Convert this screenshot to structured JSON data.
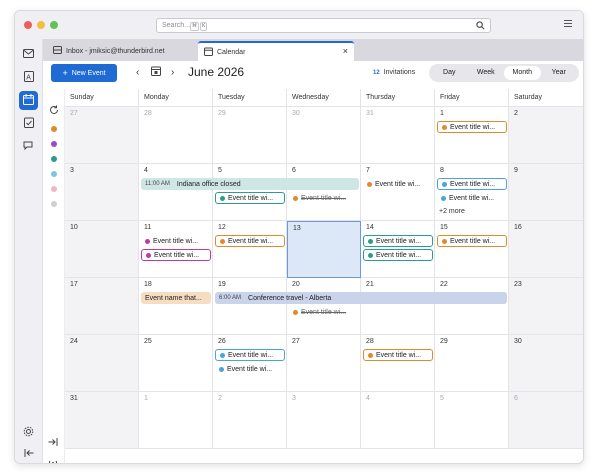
{
  "titlebar": {
    "search_placeholder": "Search...",
    "search_keys": [
      "⌘",
      "K"
    ]
  },
  "tabs": [
    {
      "label": "Inbox - jmiksic@thunderbird.net"
    },
    {
      "label": "Calendar"
    }
  ],
  "toolbar": {
    "new_event": "New Event",
    "month_label": "June 2026",
    "invitations_count": "12",
    "invitations_label": "Invitations",
    "views": [
      "Day",
      "Week",
      "Month",
      "Year"
    ],
    "active_view": "Month"
  },
  "calendar_colors": [
    "#e08a2a",
    "#9b48d8",
    "#2a9d8f",
    "#7ec6e0",
    "#f0b6c8",
    "#cfcfd4"
  ],
  "weekdays": [
    "Sunday",
    "Monday",
    "Tuesday",
    "Wednesday",
    "Thursday",
    "Friday",
    "Saturday"
  ],
  "weeks": [
    [
      {
        "d": "27",
        "o": true
      },
      {
        "d": "28",
        "o": true
      },
      {
        "d": "29",
        "o": true
      },
      {
        "d": "30",
        "o": true
      },
      {
        "d": "31",
        "o": true
      },
      {
        "d": "1"
      },
      {
        "d": "2"
      }
    ],
    [
      {
        "d": "3"
      },
      {
        "d": "4"
      },
      {
        "d": "5"
      },
      {
        "d": "6"
      },
      {
        "d": "7"
      },
      {
        "d": "8"
      },
      {
        "d": "9"
      }
    ],
    [
      {
        "d": "10"
      },
      {
        "d": "11"
      },
      {
        "d": "12"
      },
      {
        "d": "13"
      },
      {
        "d": "14"
      },
      {
        "d": "15"
      },
      {
        "d": "16"
      }
    ],
    [
      {
        "d": "17"
      },
      {
        "d": "18"
      },
      {
        "d": "19"
      },
      {
        "d": "20"
      },
      {
        "d": "21"
      },
      {
        "d": "22"
      },
      {
        "d": "23"
      }
    ],
    [
      {
        "d": "24"
      },
      {
        "d": "25"
      },
      {
        "d": "26"
      },
      {
        "d": "27"
      },
      {
        "d": "28"
      },
      {
        "d": "29"
      },
      {
        "d": "30"
      }
    ],
    [
      {
        "d": "31"
      },
      {
        "d": "1",
        "o": true
      },
      {
        "d": "2",
        "o": true
      },
      {
        "d": "3",
        "o": true
      },
      {
        "d": "4",
        "o": true
      },
      {
        "d": "5",
        "o": true
      },
      {
        "d": "6",
        "o": true
      }
    ]
  ],
  "events": {
    "e_jun1": {
      "text": "Event title wi...",
      "color": "#e08a2a"
    },
    "indiana": {
      "time": "11:00 AM",
      "text": "Indiana office closed",
      "color": "#cfe7e4"
    },
    "e_jun5": {
      "text": "Event title wi...",
      "color": "#2a9d8f"
    },
    "e_jun6": {
      "text": "Event title wi...",
      "color": "#e08a2a"
    },
    "e_jun7": {
      "text": "Event title wi...",
      "color": "#e08a2a"
    },
    "e_jun8a": {
      "text": "Event title wi...",
      "color": "#4ba3d9"
    },
    "e_jun8b": {
      "text": "Event title wi...",
      "color": "#4ba3d9"
    },
    "more_jun8": "+2 more",
    "e_jun11a": {
      "text": "Event title wi...",
      "color": "#c0399f"
    },
    "e_jun11b": {
      "text": "Event title wi...",
      "color": "#c0399f"
    },
    "e_jun12": {
      "text": "Event title wi...",
      "color": "#e08a2a"
    },
    "e_jun14a": {
      "text": "Event title wi...",
      "color": "#2a9d8f"
    },
    "e_jun14b": {
      "text": "Event title wi...",
      "color": "#2a9d8f"
    },
    "e_jun15": {
      "text": "Event title wi...",
      "color": "#e08a2a"
    },
    "e_jun18": {
      "text": "Event name that...",
      "color": "#f6dcc0"
    },
    "conference": {
      "time": "6:00 AM",
      "text": "Conference travel - Alberta",
      "color": "#c9d3ea"
    },
    "e_jun20": {
      "text": "Event title wi...",
      "color": "#e08a2a"
    },
    "e_jun26a": {
      "text": "Event title wi...",
      "color": "#4ba3d9"
    },
    "e_jun26b": {
      "text": "Event title wi...",
      "color": "#4ba3d9"
    },
    "e_jun28": {
      "text": "Event title wi...",
      "color": "#e08a2a"
    }
  }
}
